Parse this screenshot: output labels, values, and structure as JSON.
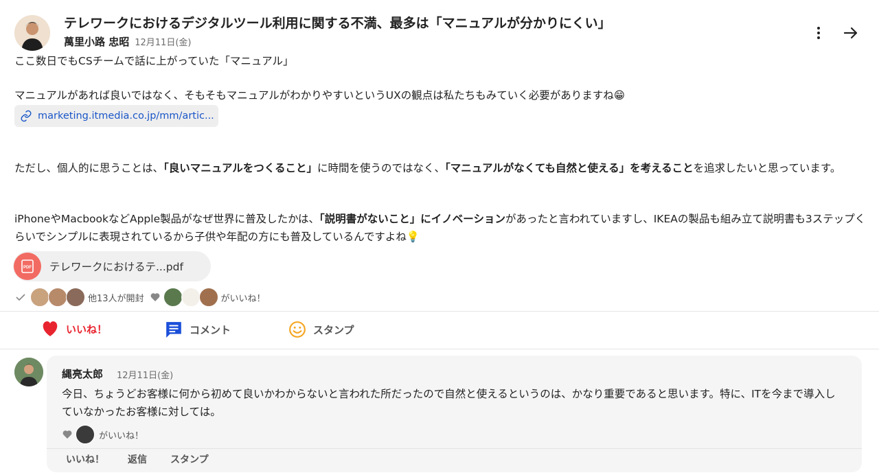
{
  "post": {
    "title": "テレワークにおけるデジタルツール利用に関する不満、最多は「マニュアルが分かりにくい」",
    "author": "萬里小路 忠昭",
    "date": "12月11日(金)",
    "more_icon": "more-vertical-icon",
    "share_icon": "arrow-right-icon",
    "para1": "ここ数日でもCSチームで話に上がっていた「マニュアル」",
    "para2": "マニュアルがあれば良いではなく、そもそもマニュアルがわかりやすいというUXの観点は私たちもみていく必要がありますね😁",
    "link_text": "marketing.itmedia.co.jp/mm/artic...",
    "para3_a": "ただし、個人的に思うことは、",
    "para3_b": "「良いマニュアルをつくること」",
    "para3_c": "に時間を使うのではなく、",
    "para3_d": "「マニュアルがなくても自然と使える」を考えること",
    "para3_e": "を追求したいと思っています。",
    "para4_a": "iPhoneやMacbookなどApple製品がなぜ世界に普及したかは、",
    "para4_b": "「説明書がないこと」にイノベーション",
    "para4_c": "があったと言われていますし、IKEAの製品も組み立て説明書も3ステップくらいでシンプルに表現されているから子供や年配の方にも普及しているんですよね💡",
    "file_name": "テレワークにおけるテ...pdf",
    "file_badge": "PDF",
    "read_text": "他13人が開封",
    "like_text": "がいいね！"
  },
  "actions": {
    "like": "いいね！",
    "comment": "コメント",
    "stamp": "スタンプ"
  },
  "comment": {
    "author": "縄亮太郎",
    "date": "12月11日(金)",
    "text": "今日、ちょうどお客様に何から初めて良いかわからないと言われた所だったので自然と使えるというのは、かなり重要であると思います。特に、ITを今まで導入していなかったお客様に対しては。",
    "like_text": "がいいね！",
    "like": "いいね！",
    "reply": "返信",
    "stamp": "スタンプ"
  },
  "colors": {
    "like_red": "#e8242f",
    "comment_blue": "#1b4fd9",
    "stamp_orange": "#f5a623",
    "link_blue": "#1a56c8",
    "pdf_red": "#f26b63"
  }
}
